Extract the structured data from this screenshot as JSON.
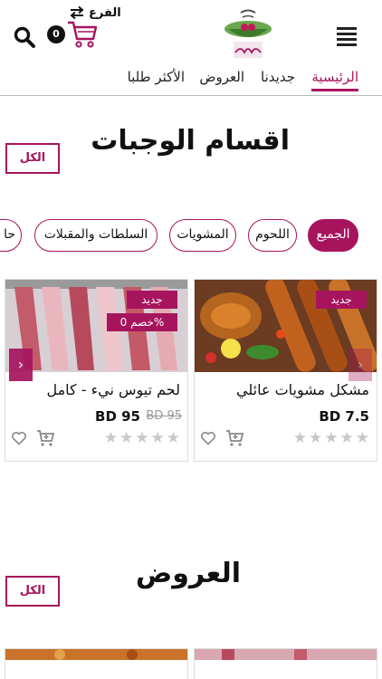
{
  "header": {
    "branch_label": "الفرع",
    "cart_count": "0"
  },
  "nav": {
    "items": [
      "الرئيسية",
      "جديدنا",
      "العروض",
      "الأكثر طلبا"
    ]
  },
  "meals_section": {
    "title": "اقسام الوجبات",
    "all_button": "الكل"
  },
  "categories": [
    "الجميع",
    "اللحوم",
    "المشويات",
    "السلطات والمقبلات",
    "حا"
  ],
  "products": [
    {
      "name": "مشكل مشويات عائلي",
      "price": "BD 7.5",
      "old_price": "",
      "new_tag": "جديد",
      "discount_tag": ""
    },
    {
      "name": "لحم تيوس نيء - كامل",
      "price": "BD 95",
      "old_price": "BD 95",
      "new_tag": "جديد",
      "discount_tag": "خصم 0%"
    }
  ],
  "offers_section": {
    "title": "العروض",
    "all_button": "الكل"
  },
  "colors": {
    "accent": "#a7145e"
  }
}
